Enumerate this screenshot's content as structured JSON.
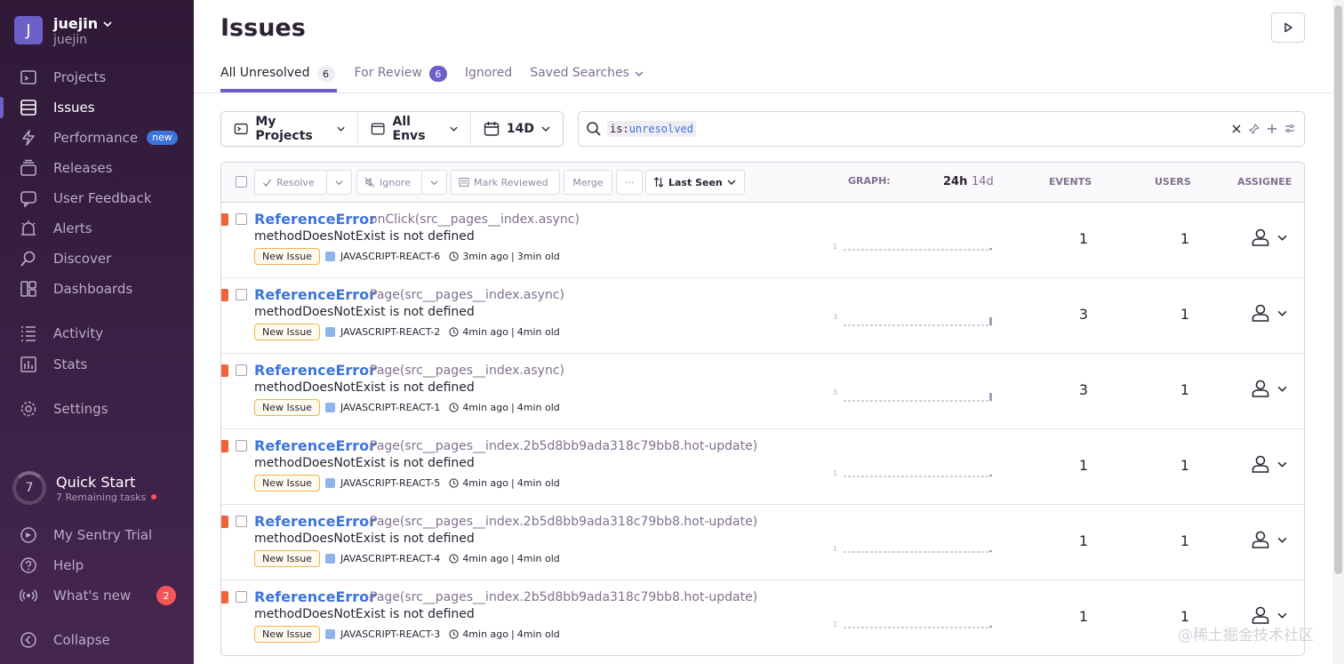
{
  "org": {
    "initial": "J",
    "name": "juejin",
    "slug": "juejin"
  },
  "sidebar": {
    "items": [
      {
        "label": "Projects",
        "icon": "projects-icon"
      },
      {
        "label": "Issues",
        "icon": "issues-icon"
      },
      {
        "label": "Performance",
        "icon": "performance-icon",
        "badge": "new"
      },
      {
        "label": "Releases",
        "icon": "releases-icon"
      },
      {
        "label": "User Feedback",
        "icon": "feedback-icon"
      },
      {
        "label": "Alerts",
        "icon": "alerts-icon"
      },
      {
        "label": "Discover",
        "icon": "discover-icon"
      },
      {
        "label": "Dashboards",
        "icon": "dashboards-icon"
      },
      {
        "label": "Activity",
        "icon": "activity-icon"
      },
      {
        "label": "Stats",
        "icon": "stats-icon"
      },
      {
        "label": "Settings",
        "icon": "settings-icon"
      }
    ],
    "quick_start": {
      "count": "7",
      "title": "Quick Start",
      "subtitle": "7 Remaining tasks"
    },
    "bottom": [
      {
        "label": "My Sentry Trial",
        "icon": "trial-icon"
      },
      {
        "label": "Help",
        "icon": "help-icon"
      },
      {
        "label": "What's new",
        "icon": "broadcast-icon",
        "count": "2"
      },
      {
        "label": "Collapse",
        "icon": "collapse-icon"
      }
    ]
  },
  "header": {
    "title": "Issues"
  },
  "tabs": [
    {
      "label": "All Unresolved",
      "count": "6"
    },
    {
      "label": "For Review",
      "count": "6"
    },
    {
      "label": "Ignored"
    },
    {
      "label": "Saved Searches"
    }
  ],
  "filters": {
    "projects": "My Projects",
    "envs": "All Envs",
    "period": "14D"
  },
  "search": {
    "token_key": "is:",
    "token_value": "unresolved"
  },
  "toolbar": {
    "resolve": "Resolve",
    "ignore": "Ignore",
    "mark_reviewed": "Mark Reviewed",
    "merge": "Merge",
    "more": "···",
    "sort": "Last Seen"
  },
  "columns": {
    "graph": "GRAPH:",
    "h24": "24h",
    "d14": "14d",
    "events": "EVENTS",
    "users": "USERS",
    "assignee": "ASSIGNEE"
  },
  "issues": [
    {
      "type": "ReferenceError",
      "culprit": "onClick(src__pages__index.async)",
      "message": "methodDoesNotExist is not defined",
      "status": "New Issue",
      "project": "JAVASCRIPT-REACT-6",
      "seen": "3min ago",
      "age": "3min old",
      "events": "1",
      "users": "1",
      "graph_max": "1"
    },
    {
      "type": "ReferenceError",
      "culprit": "Page(src__pages__index.async)",
      "message": "methodDoesNotExist is not defined",
      "status": "New Issue",
      "project": "JAVASCRIPT-REACT-2",
      "seen": "4min ago",
      "age": "4min old",
      "events": "3",
      "users": "1",
      "graph_max": "3"
    },
    {
      "type": "ReferenceError",
      "culprit": "Page(src__pages__index.async)",
      "message": "methodDoesNotExist is not defined",
      "status": "New Issue",
      "project": "JAVASCRIPT-REACT-1",
      "seen": "4min ago",
      "age": "4min old",
      "events": "3",
      "users": "1",
      "graph_max": "3"
    },
    {
      "type": "ReferenceError",
      "culprit": "Page(src__pages__index.2b5d8bb9ada318c79bb8.hot-update)",
      "message": "methodDoesNotExist is not defined",
      "status": "New Issue",
      "project": "JAVASCRIPT-REACT-5",
      "seen": "4min ago",
      "age": "4min old",
      "events": "1",
      "users": "1",
      "graph_max": "1"
    },
    {
      "type": "ReferenceError",
      "culprit": "Page(src__pages__index.2b5d8bb9ada318c79bb8.hot-update)",
      "message": "methodDoesNotExist is not defined",
      "status": "New Issue",
      "project": "JAVASCRIPT-REACT-4",
      "seen": "4min ago",
      "age": "4min old",
      "events": "1",
      "users": "1",
      "graph_max": "1"
    },
    {
      "type": "ReferenceError",
      "culprit": "Page(src__pages__index.2b5d8bb9ada318c79bb8.hot-update)",
      "message": "methodDoesNotExist is not defined",
      "status": "New Issue",
      "project": "JAVASCRIPT-REACT-3",
      "seen": "4min ago",
      "age": "4min old",
      "events": "1",
      "users": "1",
      "graph_max": "1"
    }
  ],
  "watermark": "@稀土掘金技术社区",
  "colors": {
    "sidebar_top": "#2f1937",
    "accent": "#6c5fc7",
    "link": "#3d74db",
    "level_error": "#f2633a"
  }
}
